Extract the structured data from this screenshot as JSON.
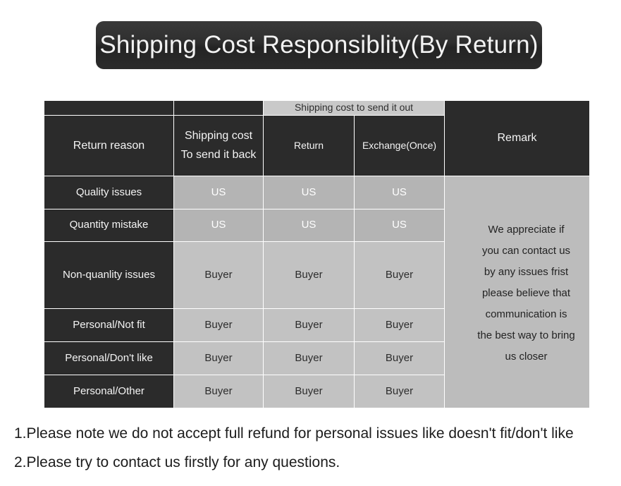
{
  "banner": {
    "title": "Shipping Cost Responsiblity(By Return)"
  },
  "table": {
    "headers": {
      "reason": "Return reason",
      "send_back_line1": "Shipping cost",
      "send_back_line2": "To send it back",
      "send_out_group": "Shipping cost to send it out",
      "sub_return": "Return",
      "sub_exchange": "Exchange(Once)",
      "remark": "Remark"
    },
    "columns": [
      "Return reason",
      "Shipping cost To send it back",
      "Return",
      "Exchange(Once)",
      "Remark"
    ],
    "rows": [
      {
        "reason": "Quality issues",
        "send_back": "US",
        "return": "US",
        "exchange": "US"
      },
      {
        "reason": "Quantity mistake",
        "send_back": "US",
        "return": "US",
        "exchange": "US"
      },
      {
        "reason": "Non-quanlity issues",
        "send_back": "Buyer",
        "return": "Buyer",
        "exchange": "Buyer"
      },
      {
        "reason": "Personal/Not fit",
        "send_back": "Buyer",
        "return": "Buyer",
        "exchange": "Buyer"
      },
      {
        "reason": "Personal/Don't like",
        "send_back": "Buyer",
        "return": "Buyer",
        "exchange": "Buyer"
      },
      {
        "reason": "Personal/Other",
        "send_back": "Buyer",
        "return": "Buyer",
        "exchange": "Buyer"
      }
    ],
    "remark_lines": [
      "We appreciate if",
      "you can contact us",
      "by any issues frist",
      "please believe that",
      "communication is",
      "the best way to bring",
      "us closer"
    ]
  },
  "notes": [
    "1.Please note we do not accept full refund for personal issues like doesn't fit/don't like",
    "2.Please try to contact us firstly for any questions."
  ],
  "colors": {
    "banner_bg": "#2b2b2b",
    "header_dark": "#2b2b2b",
    "band_light": "#c9c9c9",
    "cell_us": "#b4b4b4",
    "cell_buyer": "#c2c2c2",
    "remark_bg": "#bcbcbc",
    "page_bg": "#ffffff",
    "grid_line": "#ffffff"
  }
}
